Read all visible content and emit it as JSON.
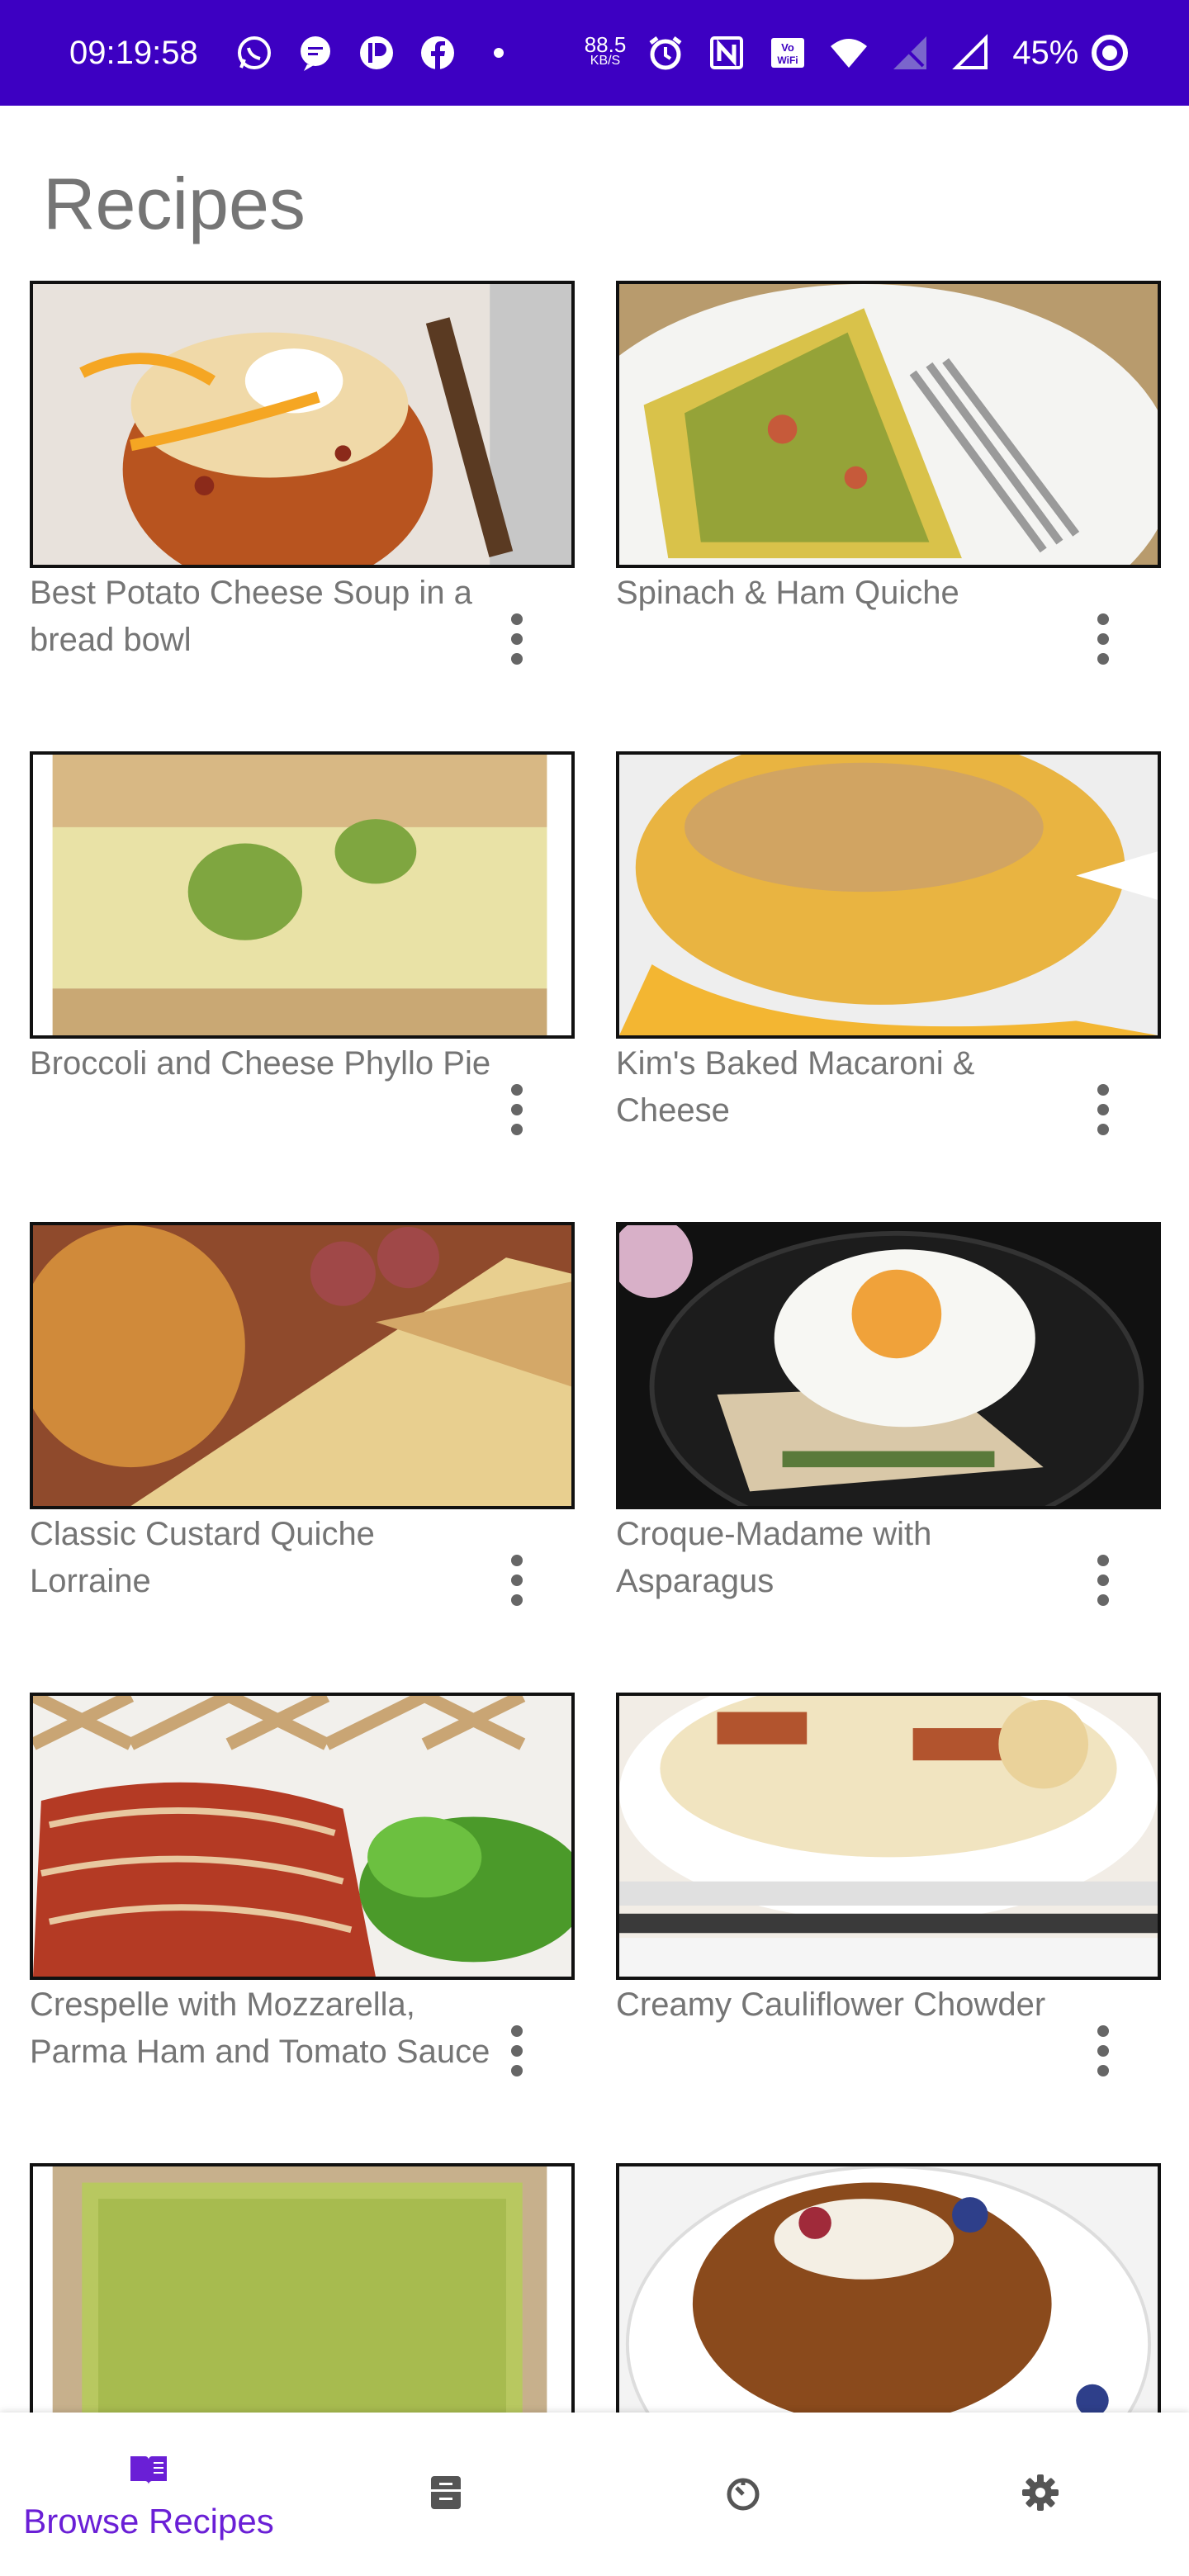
{
  "status_bar": {
    "time": "09:19:58",
    "net_speed_value": "88.5",
    "net_speed_unit": "KB/S",
    "battery": "45%"
  },
  "page": {
    "title": "Recipes"
  },
  "recipes": [
    {
      "title": "Best Potato Cheese Soup in a bread bowl"
    },
    {
      "title": "Spinach & Ham Quiche"
    },
    {
      "title": "Broccoli and Cheese Phyllo Pie"
    },
    {
      "title": "Kim's Baked Macaroni & Cheese"
    },
    {
      "title": "Classic Custard Quiche Lorraine"
    },
    {
      "title": "Croque-Madame with Asparagus"
    },
    {
      "title": "Crespelle with Mozzarella, Parma Ham and Tomato Sauce"
    },
    {
      "title": "Creamy Cauliflower Chowder"
    },
    {
      "title": ""
    },
    {
      "title": ""
    }
  ],
  "bottom_nav": {
    "items": [
      {
        "label": "Browse Recipes",
        "icon": "book-icon",
        "active": true
      },
      {
        "label": "",
        "icon": "cabinet-icon",
        "active": false
      },
      {
        "label": "",
        "icon": "timer-icon",
        "active": false
      },
      {
        "label": "",
        "icon": "gear-icon",
        "active": false
      }
    ]
  },
  "colors": {
    "status_bar": "#3d00c2",
    "accent": "#6a1fd6",
    "text_secondary": "#757575"
  }
}
